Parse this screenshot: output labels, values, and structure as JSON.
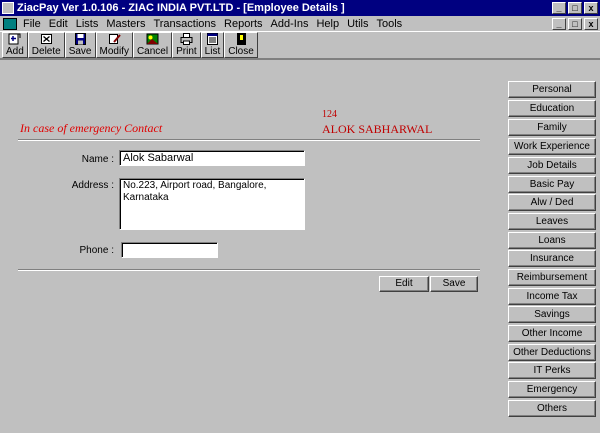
{
  "window": {
    "title": "ZiacPay Ver 1.0.106 - ZIAC INDIA PVT.LTD - [Employee Details ]",
    "controls": [
      "_",
      "□",
      "x"
    ],
    "inner_controls": [
      "_",
      "□",
      "x"
    ]
  },
  "menu": [
    "File",
    "Edit",
    "Lists",
    "Masters",
    "Transactions",
    "Reports",
    "Add-Ins",
    "Help",
    "Utils",
    "Tools"
  ],
  "toolbar": {
    "buttons": [
      {
        "label": "Add",
        "icon": "add-icon"
      },
      {
        "label": "Delete",
        "icon": "delete-icon"
      },
      {
        "label": "Save",
        "icon": "save-icon"
      },
      {
        "label": "Modify",
        "icon": "modify-icon"
      },
      {
        "label": "Cancel",
        "icon": "cancel-icon"
      },
      {
        "label": "Print",
        "icon": "print-icon"
      },
      {
        "label": "List",
        "icon": "list-icon"
      },
      {
        "label": "Close",
        "icon": "close-icon"
      }
    ]
  },
  "employee": {
    "code": "124",
    "name": "ALOK SABHARWAL"
  },
  "form": {
    "heading": "In case of emergency Contact",
    "name_label": "Name :",
    "name_value": "Alok Sabarwal",
    "address_label": "Address :",
    "address_value": "No.223, Airport road, Bangalore, Karnataka",
    "phone_label": "Phone :",
    "phone_value": "",
    "edit_label": "Edit",
    "save_label": "Save"
  },
  "sidebar": {
    "items": [
      {
        "label": "Personal"
      },
      {
        "label": "Education"
      },
      {
        "label": "Family"
      },
      {
        "label": "Work Experience"
      },
      {
        "label": "Job Details"
      },
      {
        "label": "Basic Pay"
      },
      {
        "label": "Alw / Ded"
      },
      {
        "label": "Leaves"
      },
      {
        "label": "Loans"
      },
      {
        "label": "Insurance"
      },
      {
        "label": "Reimbursement"
      },
      {
        "label": "Income Tax"
      },
      {
        "label": "Savings"
      },
      {
        "label": "Other Income"
      },
      {
        "label": "Other Deductions"
      },
      {
        "label": "IT Perks"
      },
      {
        "label": "Emergency"
      },
      {
        "label": "Others"
      }
    ]
  }
}
